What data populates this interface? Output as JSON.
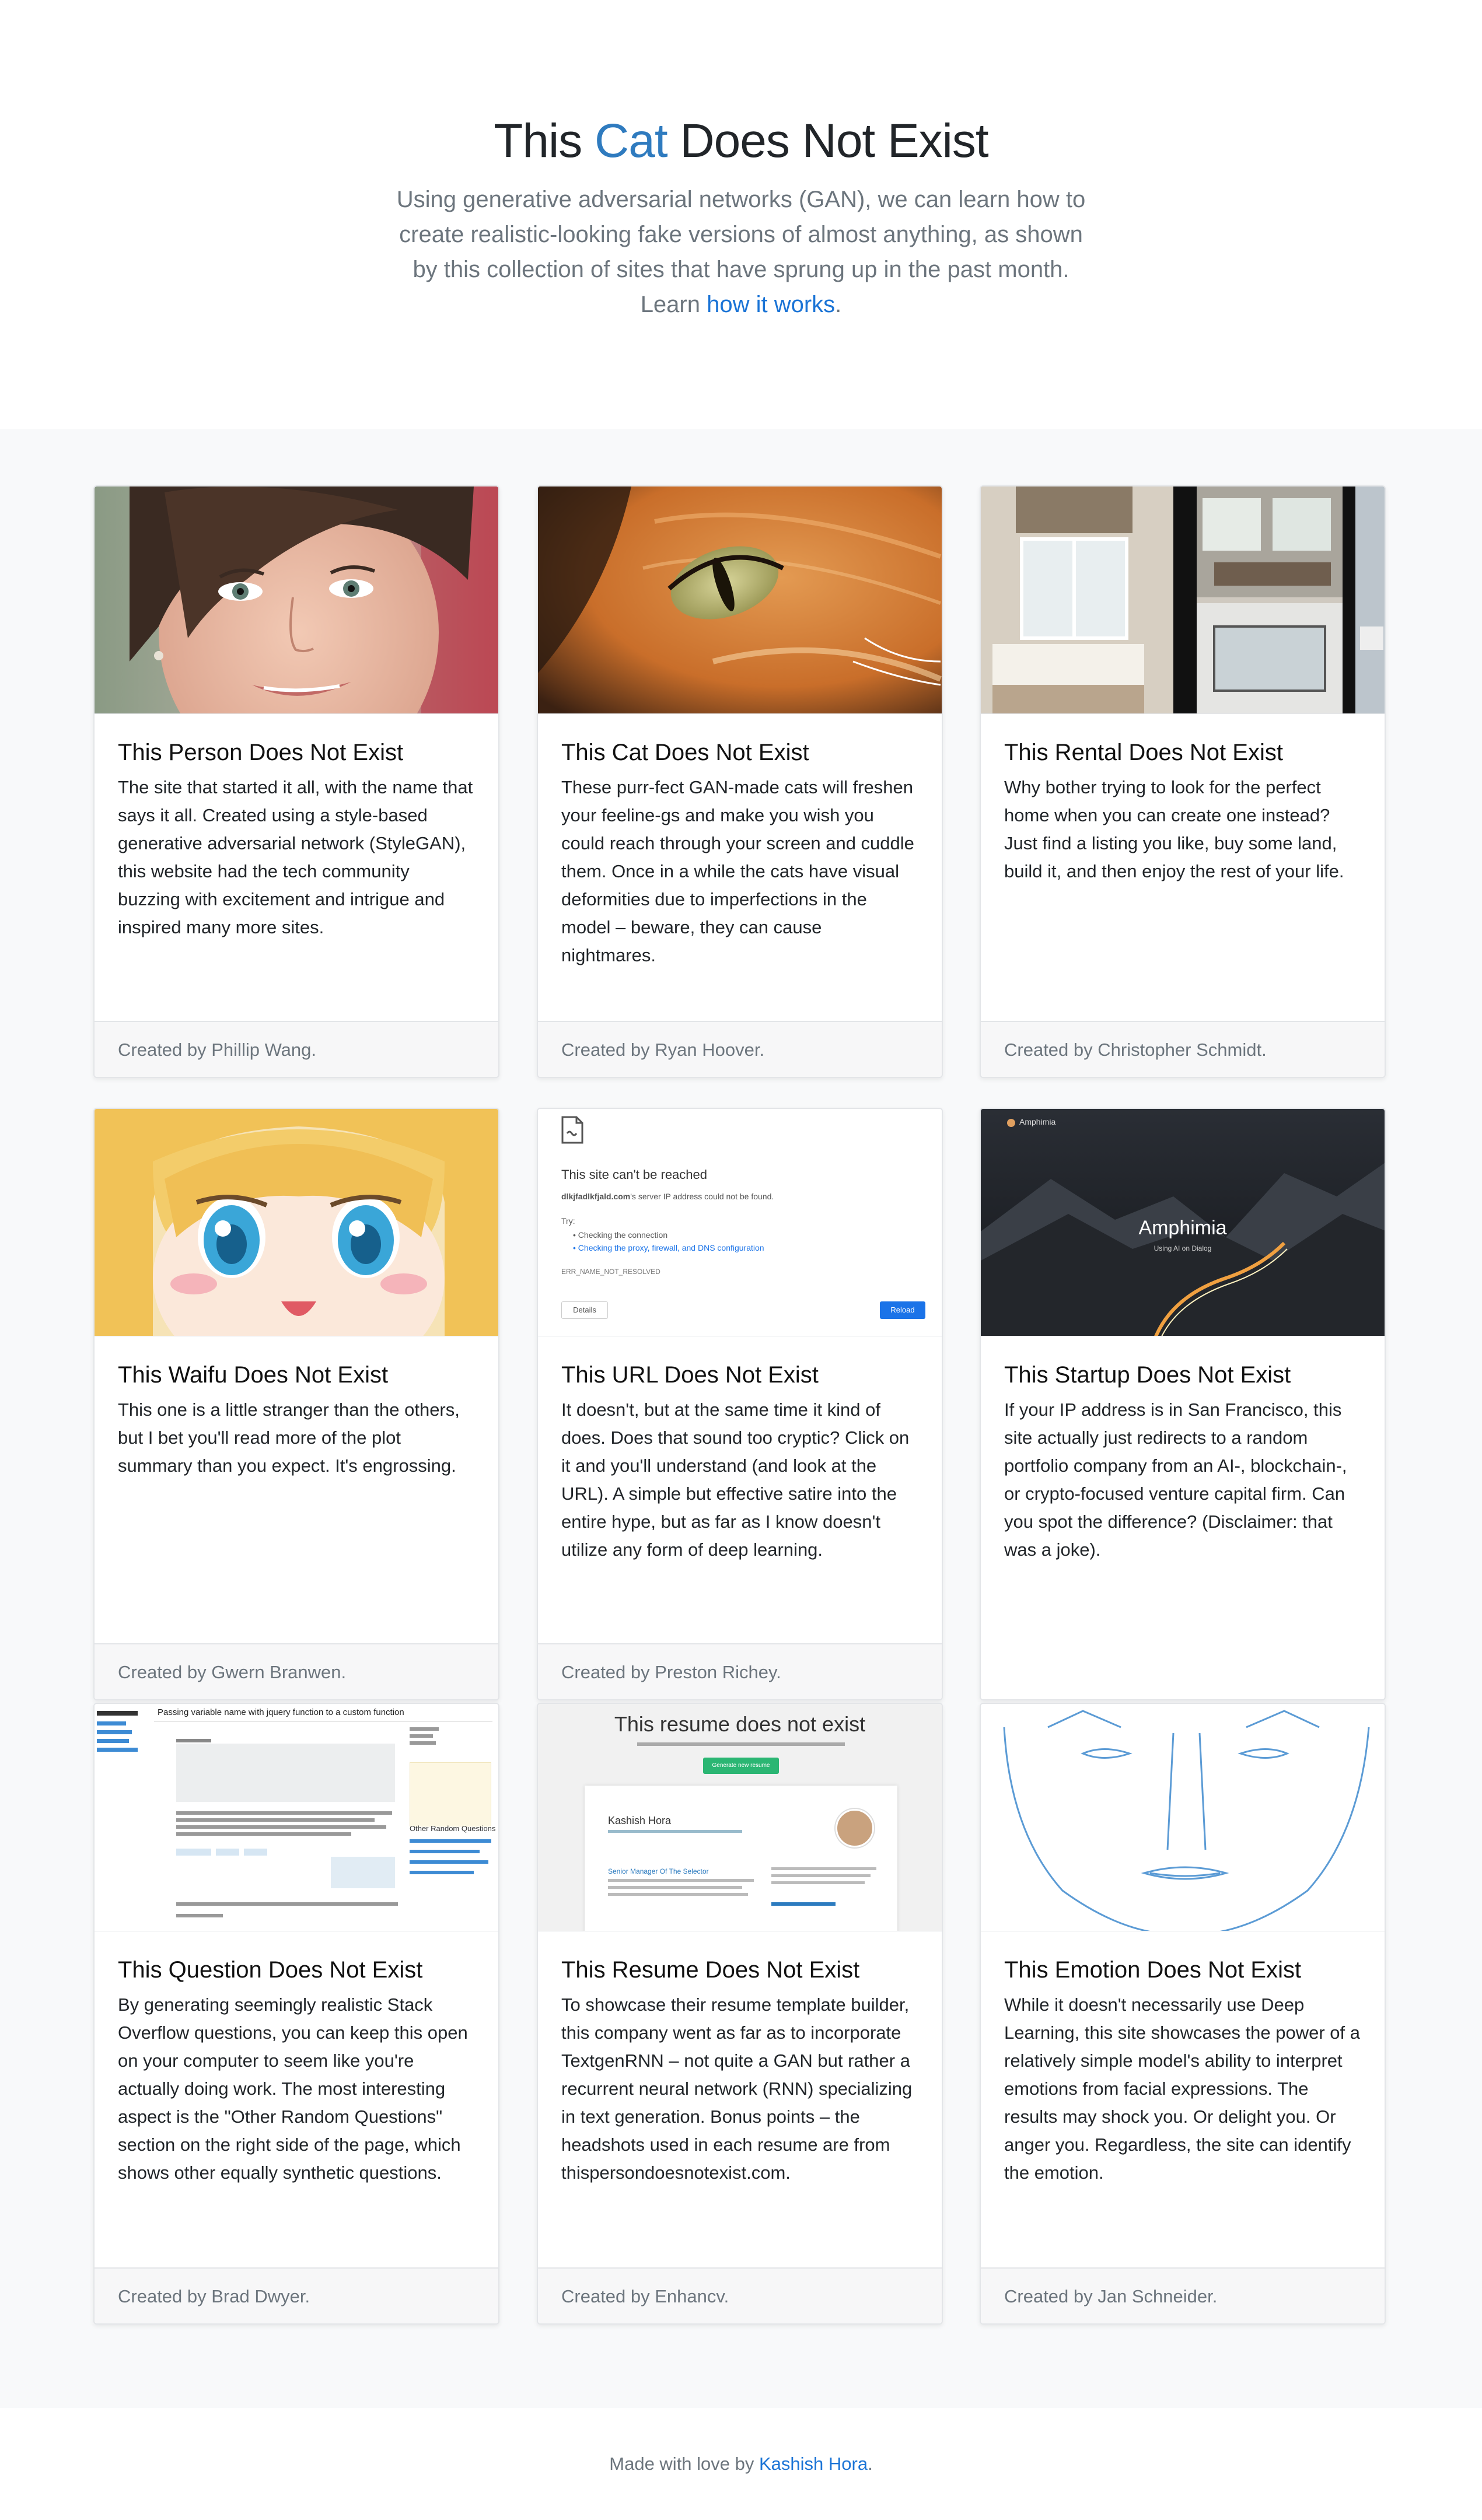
{
  "hero": {
    "title_before": "This ",
    "title_accent": "Cat",
    "title_after": " Does Not Exist",
    "lead": "Using generative adversarial networks (GAN), we can learn how to create realistic-looking fake versions of almost anything, as shown by this collection of sites that have sprung up in the past month. Learn ",
    "lead_link": "how it works",
    "lead_end": "."
  },
  "cards": [
    {
      "title": "This Person Does Not Exist",
      "text": "The site that started it all, with the name that says it all. Created using a style-based generative adversarial network (StyleGAN), this website had the tech community buzzing with excitement and intrigue and inspired many more sites.",
      "footer": "Created by Phillip Wang."
    },
    {
      "title": "This Cat Does Not Exist",
      "text": "These purr-fect GAN-made cats will freshen your feeline-gs and make you wish you could reach through your screen and cuddle them. Once in a while the cats have visual deformities due to imperfections in the model – beware, they can cause nightmares.",
      "footer": "Created by Ryan Hoover."
    },
    {
      "title": "This Rental Does Not Exist",
      "text": "Why bother trying to look for the perfect home when you can create one instead? Just find a listing you like, buy some land, build it, and then enjoy the rest of your life.",
      "footer": "Created by Christopher Schmidt."
    },
    {
      "title": "This Waifu Does Not Exist",
      "text": "This one is a little stranger than the others, but I bet you'll read more of the plot summary than you expect. It's engrossing.",
      "footer": "Created by Gwern Branwen."
    },
    {
      "title": "This URL Does Not Exist",
      "text": "It doesn't, but at the same time it kind of does. Does that sound too cryptic? Click on it and you'll understand (and look at the URL). A simple but effective satire into the entire hype, but as far as I know doesn't utilize any form of deep learning.",
      "footer": "Created by Preston Richey.",
      "shot": {
        "heading": "This site can't be reached",
        "domain": "dlkjfadlkfjald.com",
        "desc": "'s server IP address could not be found.",
        "try": "Try:",
        "item1": "Checking the connection",
        "item2": "Checking the proxy, firewall, and DNS configuration",
        "code": "ERR_NAME_NOT_RESOLVED",
        "details": "Details",
        "reload": "Reload"
      }
    },
    {
      "title": "This Startup Does Not Exist",
      "text": "If your IP address is in San Francisco, this site actually just redirects to a random portfolio company from an AI-, blockchain-, or crypto-focused venture capital firm. Can you spot the difference? (Disclaimer: that was a joke).",
      "footer": "",
      "shot": {
        "brand": "Amphimia",
        "headline": "Amphimia",
        "tagline": "Using AI on Dialog"
      }
    },
    {
      "title": "This Question Does Not Exist",
      "text": "By generating seemingly realistic Stack Overflow questions, you can keep this open on your computer to seem like you're actually doing work. The most interesting aspect is the \"Other Random Questions\" section on the right side of the page, which shows other equally synthetic questions.",
      "footer": "Created by Brad Dwyer.",
      "shot": {
        "question": "Passing variable name with jquery function to a custom function",
        "related": "Other Random Questions"
      }
    },
    {
      "title": "This Resume Does Not Exist",
      "text": "To showcase their resume template builder, this company went as far as to incorporate TextgenRNN – not quite a GAN but rather a recurrent neural network (RNN) specializing in text generation. Bonus points – the headshots used in each resume are from thispersondoesnotexist.com.",
      "footer": "Created by Enhancv.",
      "shot": {
        "heading": "This resume does not exist",
        "name": "Kashish Hora",
        "role": "Senior Manager Of The Selector",
        "button": "Generate new resume"
      }
    },
    {
      "title": "This Emotion Does Not Exist",
      "text": "While it doesn't necessarily use Deep Learning, this site showcases the power of a relatively simple model's ability to interpret emotions from facial expressions. The results may shock you. Or delight you. Or anger you. Regardless, the site can identify the emotion.",
      "footer": "Created by Jan Schneider."
    }
  ],
  "footer": {
    "text": "Made with love by ",
    "link": "Kashish Hora",
    "end": "."
  },
  "colors": {
    "accent": "#2f7bbf",
    "link": "#1b74d6",
    "muted": "#6c757d",
    "background": "#f8f9fa"
  },
  "icons": [
    "broken-page-icon"
  ]
}
